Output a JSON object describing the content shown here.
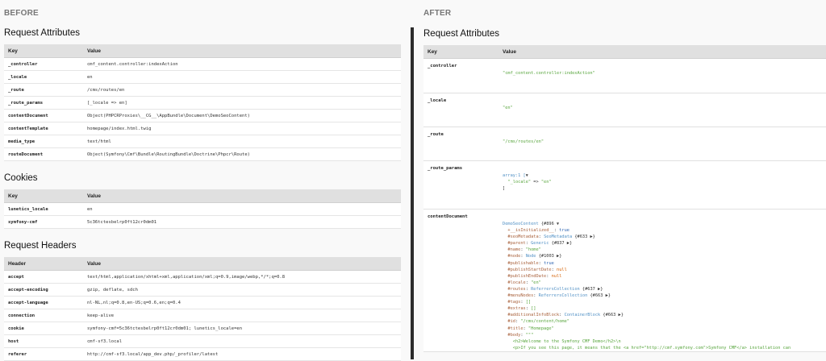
{
  "before": {
    "title": "BEFORE",
    "request_attributes": {
      "title": "Request Attributes",
      "headers": [
        "Key",
        "Value"
      ],
      "rows": [
        {
          "key": "_controller",
          "value": "cmf_content.controller:indexAction"
        },
        {
          "key": "_locale",
          "value": "en"
        },
        {
          "key": "_route",
          "value": "/cms/routes/en"
        },
        {
          "key": "_route_params",
          "value": "[_locale => en]"
        },
        {
          "key": "contentDocument",
          "value": "Object(PHPCRProxies\\__CG__\\AppBundle\\Document\\DemoSeoContent)"
        },
        {
          "key": "contentTemplate",
          "value": "homepage/index.html.twig"
        },
        {
          "key": "media_type",
          "value": "text/html"
        },
        {
          "key": "routeDocument",
          "value": "Object(Symfony\\Cmf\\Bundle\\RoutingBundle\\Doctrine\\Phpcr\\Route)"
        }
      ]
    },
    "cookies": {
      "title": "Cookies",
      "headers": [
        "Key",
        "Value"
      ],
      "rows": [
        {
          "key": "lunetics_locale",
          "value": "en"
        },
        {
          "key": "symfony-cmf",
          "value": "5c36tctesbelrp0ft12cr0dm01"
        }
      ]
    },
    "request_headers": {
      "title": "Request Headers",
      "headers": [
        "Header",
        "Value"
      ],
      "rows": [
        {
          "key": "accept",
          "value": "text/html,application/xhtml+xml,application/xml;q=0.9,image/webp,*/*;q=0.8"
        },
        {
          "key": "accept-encoding",
          "value": "gzip, deflate, sdch"
        },
        {
          "key": "accept-language",
          "value": "nl-NL,nl;q=0.8,en-US;q=0.6,en;q=0.4"
        },
        {
          "key": "connection",
          "value": "keep-alive"
        },
        {
          "key": "cookie",
          "value": "symfony-cmf=5c36tctesbelrp0ft12cr0dm01; lunetics_locale=en"
        },
        {
          "key": "host",
          "value": "cmf-sf3.local"
        },
        {
          "key": "referer",
          "value": "http://cmf-sf3.local/app_dev.php/_profiler/latest"
        }
      ]
    }
  },
  "after": {
    "title": "AFTER",
    "request_attributes": {
      "title": "Request Attributes",
      "headers": [
        "Key",
        "Value"
      ],
      "controller": {
        "key": "_controller",
        "value": "\"cmf_content.controller:indexAction\""
      },
      "locale": {
        "key": "_locale",
        "value": "\"en\""
      },
      "route": {
        "key": "_route",
        "value": "\"/cms/routes/en\""
      },
      "route_params": {
        "key": "_route_params",
        "line1": "array:1 [",
        "arrow": "▼",
        "line2_key": "\"_locale\"",
        "line2_op": " => ",
        "line2_val": "\"en\"",
        "line3": "]"
      },
      "content_document": {
        "key": "contentDocument",
        "class": "DemoSeoContent",
        "ref": "{#896",
        "lines": [
          {
            "prop": "+__isInitialized__",
            "sep": ": ",
            "val": "true",
            "type": "n"
          },
          {
            "prop": "#seoMetadata",
            "sep": ": ",
            "val": "SeoMetadata",
            "ref": " {#633 ▶}",
            "type": "c"
          },
          {
            "prop": "#parent",
            "sep": ": ",
            "val": "Generic",
            "ref": " {#837 ▶}",
            "type": "c"
          },
          {
            "prop": "#name",
            "sep": ": ",
            "val": "\"home\"",
            "type": "s"
          },
          {
            "prop": "#node",
            "sep": ": ",
            "val": "Node",
            "ref": " {#1003 ▶}",
            "type": "c"
          },
          {
            "prop": "#publishable",
            "sep": ": ",
            "val": "true",
            "type": "n"
          },
          {
            "prop": "#publishStartDate",
            "sep": ": ",
            "val": "null",
            "type": "bl"
          },
          {
            "prop": "#publishEndDate",
            "sep": ": ",
            "val": "null",
            "type": "bl"
          },
          {
            "prop": "#locale",
            "sep": ": ",
            "val": "\"en\"",
            "type": "s"
          },
          {
            "prop": "#routes",
            "sep": ": ",
            "val": "ReferrersCollection",
            "ref": " {#637 ▶}",
            "type": "c"
          },
          {
            "prop": "#menuNodes",
            "sep": ": ",
            "val": "ReferrersCollection",
            "ref": " {#663 ▶}",
            "type": "c"
          },
          {
            "prop": "#tags",
            "sep": ": ",
            "val": "[]",
            "type": "s"
          },
          {
            "prop": "#extras",
            "sep": ": ",
            "val": "[]",
            "type": "s"
          },
          {
            "prop": "#additionalInfoBlock",
            "sep": ": ",
            "val": "ContainerBlock",
            "ref": " {#663 ▶}",
            "type": "c"
          },
          {
            "prop": "#id",
            "sep": ": ",
            "val": "\"/cms/content/home\"",
            "type": "s"
          },
          {
            "prop": "#title",
            "sep": ": ",
            "val": "\"Homepage\"",
            "type": "s"
          },
          {
            "prop": "#body",
            "sep": ": ",
            "val": "\"\"\"",
            "type": "s"
          }
        ],
        "body_line1": "<h2>Welcome to the Symfony CMF Demo</h2>\\n",
        "body_line2": "<p>If you see this page, it means that the <a href=\"http://cmf.symfony.com\">Symfony CMF</a> installation can"
      }
    }
  }
}
